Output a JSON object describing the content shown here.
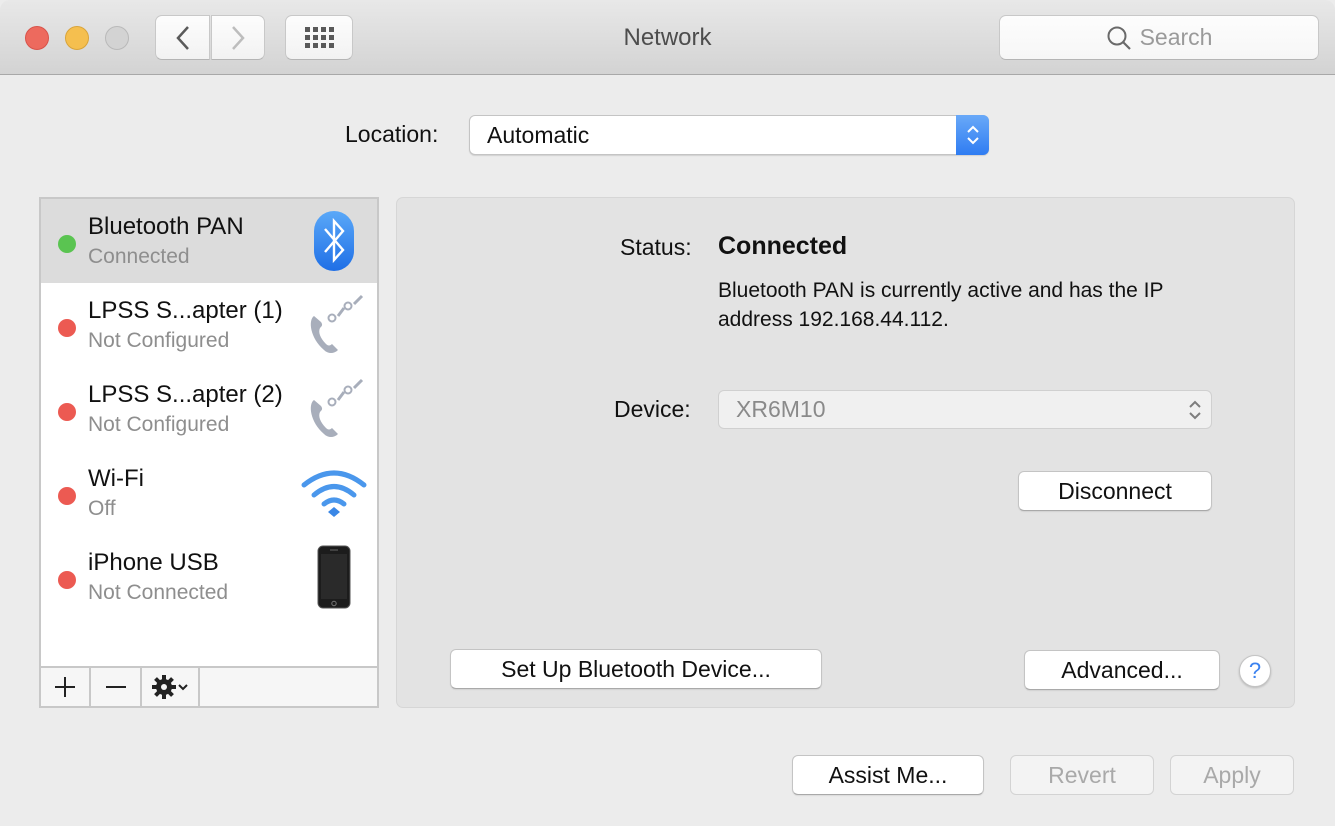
{
  "window": {
    "title": "Network",
    "search_placeholder": "Search",
    "icons": {
      "close": "close-traffic-light",
      "minimize": "minimize-traffic-light",
      "zoom": "zoom-traffic-light",
      "back": "chevron-left-icon",
      "forward": "chevron-right-icon",
      "show_all": "grid-icon",
      "search": "magnifier-icon"
    }
  },
  "location": {
    "label": "Location:",
    "value": "Automatic"
  },
  "services": [
    {
      "name": "Bluetooth PAN",
      "status": "Connected",
      "status_color": "#5ac451",
      "icon": "bluetooth-icon",
      "selected": true
    },
    {
      "name": "LPSS S...apter (1)",
      "status": "Not Configured",
      "status_color": "#ec5a52",
      "icon": "modem-phone-icon",
      "selected": false
    },
    {
      "name": "LPSS S...apter (2)",
      "status": "Not Configured",
      "status_color": "#ec5a52",
      "icon": "modem-phone-icon",
      "selected": false
    },
    {
      "name": "Wi-Fi",
      "status": "Off",
      "status_color": "#ec5a52",
      "icon": "wifi-icon",
      "selected": false
    },
    {
      "name": "iPhone USB",
      "status": "Not Connected",
      "status_color": "#ec5a52",
      "icon": "iphone-icon",
      "selected": false
    }
  ],
  "sidebar_toolbar": {
    "add": "+",
    "remove": "−",
    "action": "gear-menu"
  },
  "detail": {
    "status_label": "Status:",
    "status_value": "Connected",
    "status_description": "Bluetooth PAN is currently active and has the IP address 192.168.44.112.",
    "device_label": "Device:",
    "device_value": "XR6M10",
    "disconnect_label": "Disconnect",
    "setup_bluetooth_label": "Set Up Bluetooth Device...",
    "advanced_label": "Advanced...",
    "help_label": "?"
  },
  "footer": {
    "assist_label": "Assist Me...",
    "revert_label": "Revert",
    "apply_label": "Apply"
  },
  "colors": {
    "accent": "#3b82f0",
    "connected": "#5ac451",
    "disconnected": "#ec5a52"
  }
}
